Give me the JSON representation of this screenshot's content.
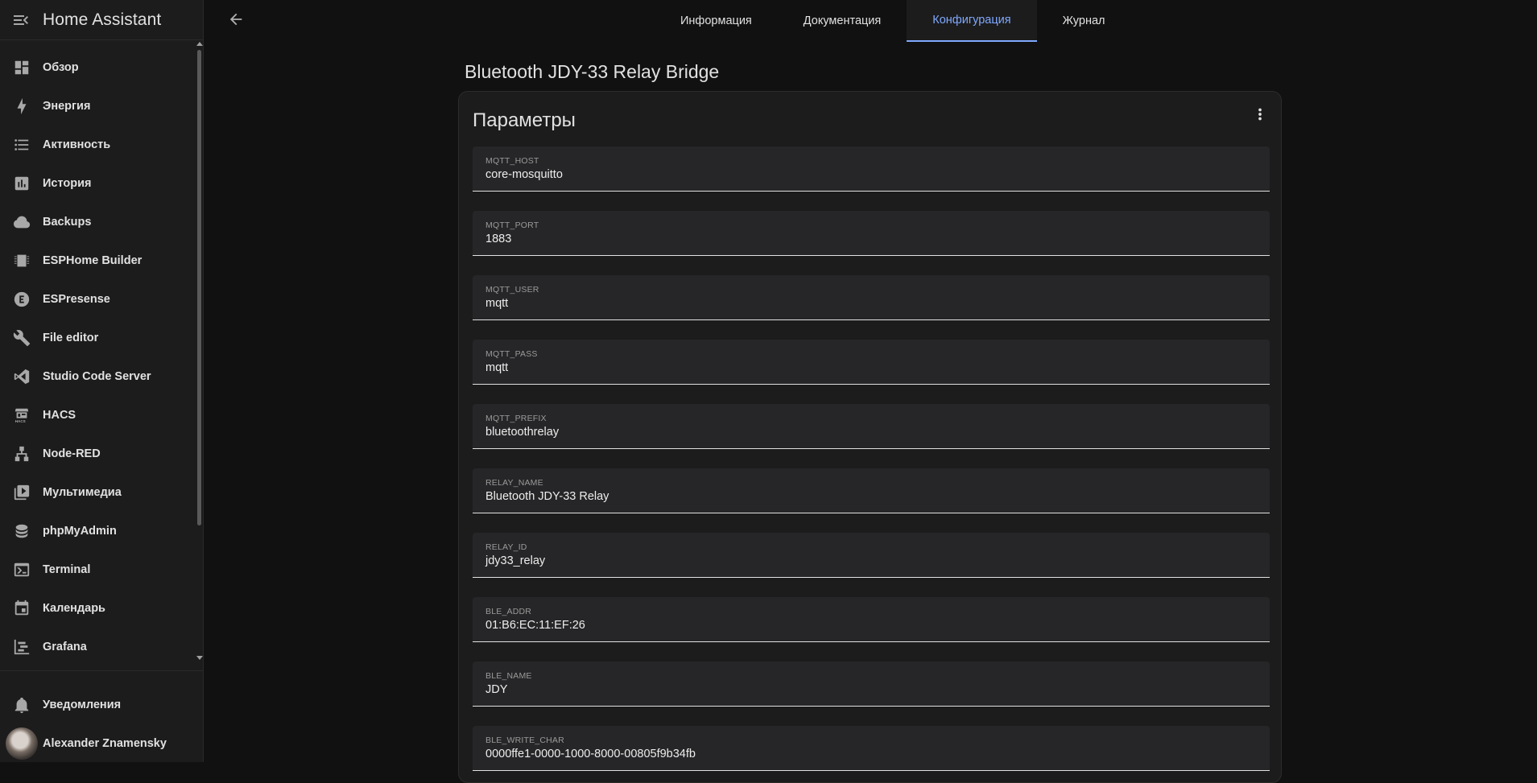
{
  "sidebar": {
    "title": "Home Assistant",
    "items": [
      {
        "label": "Обзор",
        "icon": "dashboard-icon"
      },
      {
        "label": "Энергия",
        "icon": "lightning-icon"
      },
      {
        "label": "Активность",
        "icon": "list-icon"
      },
      {
        "label": "История",
        "icon": "chart-icon"
      },
      {
        "label": "Backups",
        "icon": "cloud-icon"
      },
      {
        "label": "ESPHome Builder",
        "icon": "chip-icon"
      },
      {
        "label": "ESPresense",
        "icon": "espresense-icon"
      },
      {
        "label": "File editor",
        "icon": "wrench-icon"
      },
      {
        "label": "Studio Code Server",
        "icon": "vscode-icon"
      },
      {
        "label": "HACS",
        "icon": "hacs-icon"
      },
      {
        "label": "Node-RED",
        "icon": "sitemap-icon"
      },
      {
        "label": "Мультимедиа",
        "icon": "play-box-icon"
      },
      {
        "label": "phpMyAdmin",
        "icon": "database-icon"
      },
      {
        "label": "Terminal",
        "icon": "console-icon"
      },
      {
        "label": "Календарь",
        "icon": "calendar-icon"
      },
      {
        "label": "Grafana",
        "icon": "chart-timeline-icon"
      }
    ],
    "notifications_label": "Уведомления",
    "user_name": "Alexander Znamensky"
  },
  "tabs": [
    {
      "label": "Информация",
      "active": false
    },
    {
      "label": "Документация",
      "active": false
    },
    {
      "label": "Конфигурация",
      "active": true
    },
    {
      "label": "Журнал",
      "active": false
    }
  ],
  "page": {
    "title": "Bluetooth JDY-33 Relay Bridge",
    "card_title": "Параметры"
  },
  "fields": [
    {
      "label": "MQTT_HOST",
      "value": "core-mosquitto"
    },
    {
      "label": "MQTT_PORT",
      "value": "1883"
    },
    {
      "label": "MQTT_USER",
      "value": "mqtt"
    },
    {
      "label": "MQTT_PASS",
      "value": "mqtt"
    },
    {
      "label": "MQTT_PREFIX",
      "value": "bluetoothrelay"
    },
    {
      "label": "RELAY_NAME",
      "value": "Bluetooth JDY-33 Relay"
    },
    {
      "label": "RELAY_ID",
      "value": "jdy33_relay"
    },
    {
      "label": "BLE_ADDR",
      "value": "01:B6:EC:11:EF:26"
    },
    {
      "label": "BLE_NAME",
      "value": "JDY"
    },
    {
      "label": "BLE_WRITE_CHAR",
      "value": "0000ffe1-0000-1000-8000-00805f9b34fb"
    }
  ],
  "colors": {
    "accent": "#7fa9ff",
    "sidebar_bg": "#1c1c1c",
    "page_bg": "#111111",
    "field_bg": "#262628"
  }
}
